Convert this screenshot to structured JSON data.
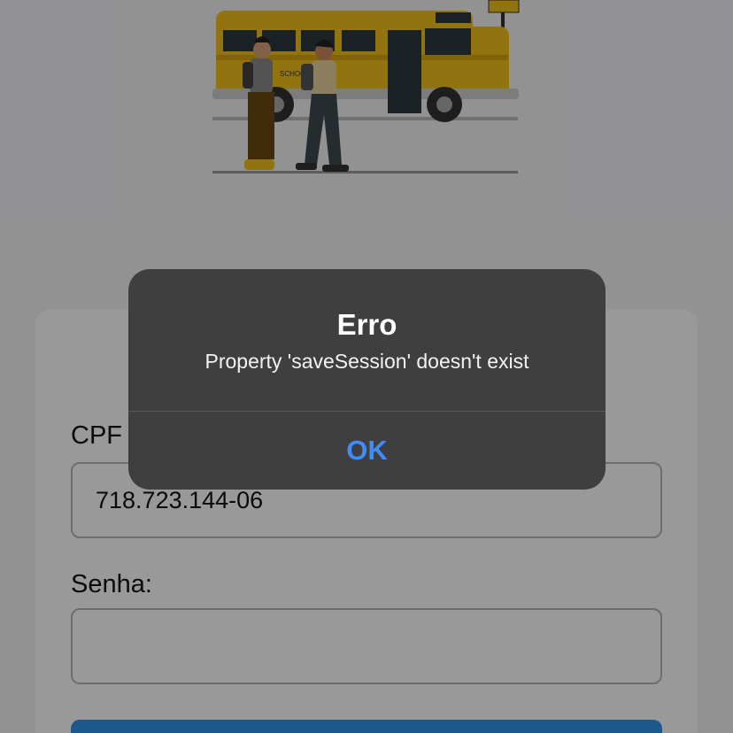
{
  "hero": {
    "icon": "school-bus-illustration",
    "bus_text": "SCHOOL"
  },
  "form": {
    "cpf_label": "CPF",
    "cpf_value": "718.723.144-06",
    "senha_label": "Senha:",
    "senha_value": ""
  },
  "alert": {
    "title": "Erro",
    "message": "Property 'saveSession' doesn't exist",
    "ok_label": "OK"
  },
  "colors": {
    "accent": "#3f8cff",
    "button": "#2f93e8",
    "bus": "#f2c01a"
  }
}
